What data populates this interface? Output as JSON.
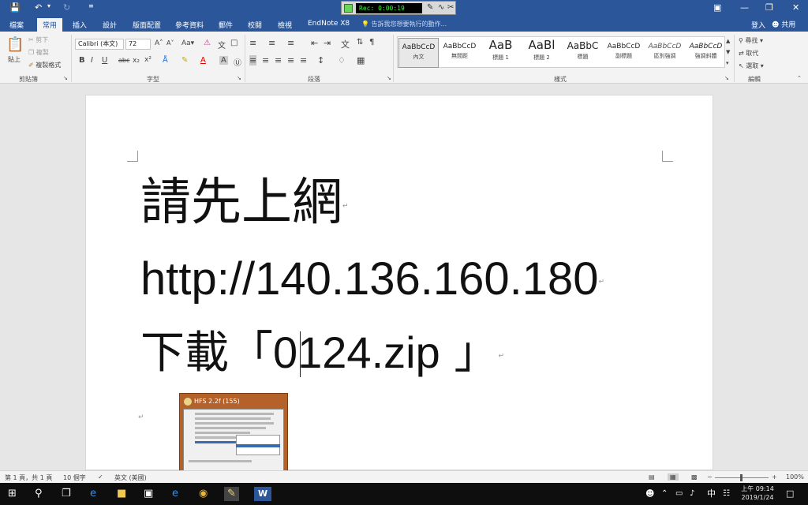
{
  "recorder": {
    "time": "Rec: 0:00:19"
  },
  "tabs": [
    {
      "label": "檔案"
    },
    {
      "label": "常用"
    },
    {
      "label": "插入"
    },
    {
      "label": "設計"
    },
    {
      "label": "版面配置"
    },
    {
      "label": "參考資料"
    },
    {
      "label": "郵件"
    },
    {
      "label": "校閱"
    },
    {
      "label": "檢視"
    },
    {
      "label": "EndNote X8"
    }
  ],
  "tell_me": "告訴我您想要執行的動作...",
  "signin": "登入",
  "share": "共用",
  "ribbon": {
    "clipboard": {
      "paste": "貼上",
      "cut": "剪下",
      "copy": "複製",
      "format_painter": "複製格式",
      "label": "剪貼簿"
    },
    "font": {
      "name": "Calibri (本文)",
      "size": "72",
      "label": "字型"
    },
    "paragraph": {
      "label": "段落"
    },
    "styles": {
      "label": "樣式",
      "items": [
        {
          "sample": "AaBbCcD",
          "name": "內文"
        },
        {
          "sample": "AaBbCcD",
          "name": "無間距"
        },
        {
          "sample": "AaB",
          "name": "標題 1"
        },
        {
          "sample": "AaBl",
          "name": "標題 2"
        },
        {
          "sample": "AaBbC",
          "name": "標題"
        },
        {
          "sample": "AaBbCcD",
          "name": "副標題"
        },
        {
          "sample": "AaBbCcD",
          "name": "區別強調"
        },
        {
          "sample": "AaBbCcD",
          "name": "強調斜體"
        }
      ]
    },
    "editing": {
      "find": "尋找",
      "replace": "取代",
      "select": "選取",
      "label": "編輯"
    }
  },
  "document": {
    "line1": "請先上網",
    "line2": "http://140.136.160.180",
    "line3_cjk": "下載「",
    "line3_file": "0124.zip",
    "line3_end": "」"
  },
  "popup": {
    "title": "HFS 2.2f (155)"
  },
  "status": {
    "page": "第 1 頁，共 1 頁",
    "words": "10 個字",
    "lang": "英文 (美國)",
    "zoom": "100%"
  },
  "clock": {
    "time": "上午 09:14",
    "date": "2019/1/24"
  },
  "ime": "中"
}
